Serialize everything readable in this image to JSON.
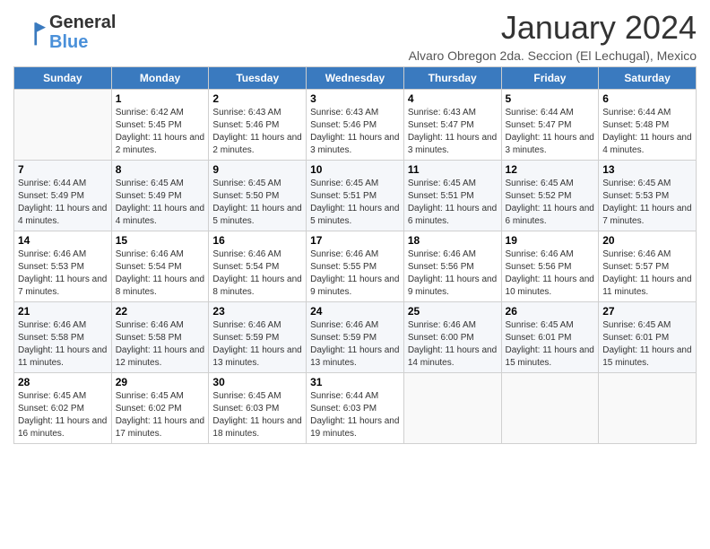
{
  "logo": {
    "general": "General",
    "blue": "Blue"
  },
  "title": "January 2024",
  "location": "Alvaro Obregon 2da. Seccion (El Lechugal), Mexico",
  "days_header": [
    "Sunday",
    "Monday",
    "Tuesday",
    "Wednesday",
    "Thursday",
    "Friday",
    "Saturday"
  ],
  "weeks": [
    [
      {
        "day": "",
        "info": ""
      },
      {
        "day": "1",
        "info": "Sunrise: 6:42 AM\nSunset: 5:45 PM\nDaylight: 11 hours and 2 minutes."
      },
      {
        "day": "2",
        "info": "Sunrise: 6:43 AM\nSunset: 5:46 PM\nDaylight: 11 hours and 2 minutes."
      },
      {
        "day": "3",
        "info": "Sunrise: 6:43 AM\nSunset: 5:46 PM\nDaylight: 11 hours and 3 minutes."
      },
      {
        "day": "4",
        "info": "Sunrise: 6:43 AM\nSunset: 5:47 PM\nDaylight: 11 hours and 3 minutes."
      },
      {
        "day": "5",
        "info": "Sunrise: 6:44 AM\nSunset: 5:47 PM\nDaylight: 11 hours and 3 minutes."
      },
      {
        "day": "6",
        "info": "Sunrise: 6:44 AM\nSunset: 5:48 PM\nDaylight: 11 hours and 4 minutes."
      }
    ],
    [
      {
        "day": "7",
        "info": "Sunrise: 6:44 AM\nSunset: 5:49 PM\nDaylight: 11 hours and 4 minutes."
      },
      {
        "day": "8",
        "info": "Sunrise: 6:45 AM\nSunset: 5:49 PM\nDaylight: 11 hours and 4 minutes."
      },
      {
        "day": "9",
        "info": "Sunrise: 6:45 AM\nSunset: 5:50 PM\nDaylight: 11 hours and 5 minutes."
      },
      {
        "day": "10",
        "info": "Sunrise: 6:45 AM\nSunset: 5:51 PM\nDaylight: 11 hours and 5 minutes."
      },
      {
        "day": "11",
        "info": "Sunrise: 6:45 AM\nSunset: 5:51 PM\nDaylight: 11 hours and 6 minutes."
      },
      {
        "day": "12",
        "info": "Sunrise: 6:45 AM\nSunset: 5:52 PM\nDaylight: 11 hours and 6 minutes."
      },
      {
        "day": "13",
        "info": "Sunrise: 6:45 AM\nSunset: 5:53 PM\nDaylight: 11 hours and 7 minutes."
      }
    ],
    [
      {
        "day": "14",
        "info": "Sunrise: 6:46 AM\nSunset: 5:53 PM\nDaylight: 11 hours and 7 minutes."
      },
      {
        "day": "15",
        "info": "Sunrise: 6:46 AM\nSunset: 5:54 PM\nDaylight: 11 hours and 8 minutes."
      },
      {
        "day": "16",
        "info": "Sunrise: 6:46 AM\nSunset: 5:54 PM\nDaylight: 11 hours and 8 minutes."
      },
      {
        "day": "17",
        "info": "Sunrise: 6:46 AM\nSunset: 5:55 PM\nDaylight: 11 hours and 9 minutes."
      },
      {
        "day": "18",
        "info": "Sunrise: 6:46 AM\nSunset: 5:56 PM\nDaylight: 11 hours and 9 minutes."
      },
      {
        "day": "19",
        "info": "Sunrise: 6:46 AM\nSunset: 5:56 PM\nDaylight: 11 hours and 10 minutes."
      },
      {
        "day": "20",
        "info": "Sunrise: 6:46 AM\nSunset: 5:57 PM\nDaylight: 11 hours and 11 minutes."
      }
    ],
    [
      {
        "day": "21",
        "info": "Sunrise: 6:46 AM\nSunset: 5:58 PM\nDaylight: 11 hours and 11 minutes."
      },
      {
        "day": "22",
        "info": "Sunrise: 6:46 AM\nSunset: 5:58 PM\nDaylight: 11 hours and 12 minutes."
      },
      {
        "day": "23",
        "info": "Sunrise: 6:46 AM\nSunset: 5:59 PM\nDaylight: 11 hours and 13 minutes."
      },
      {
        "day": "24",
        "info": "Sunrise: 6:46 AM\nSunset: 5:59 PM\nDaylight: 11 hours and 13 minutes."
      },
      {
        "day": "25",
        "info": "Sunrise: 6:46 AM\nSunset: 6:00 PM\nDaylight: 11 hours and 14 minutes."
      },
      {
        "day": "26",
        "info": "Sunrise: 6:45 AM\nSunset: 6:01 PM\nDaylight: 11 hours and 15 minutes."
      },
      {
        "day": "27",
        "info": "Sunrise: 6:45 AM\nSunset: 6:01 PM\nDaylight: 11 hours and 15 minutes."
      }
    ],
    [
      {
        "day": "28",
        "info": "Sunrise: 6:45 AM\nSunset: 6:02 PM\nDaylight: 11 hours and 16 minutes."
      },
      {
        "day": "29",
        "info": "Sunrise: 6:45 AM\nSunset: 6:02 PM\nDaylight: 11 hours and 17 minutes."
      },
      {
        "day": "30",
        "info": "Sunrise: 6:45 AM\nSunset: 6:03 PM\nDaylight: 11 hours and 18 minutes."
      },
      {
        "day": "31",
        "info": "Sunrise: 6:44 AM\nSunset: 6:03 PM\nDaylight: 11 hours and 19 minutes."
      },
      {
        "day": "",
        "info": ""
      },
      {
        "day": "",
        "info": ""
      },
      {
        "day": "",
        "info": ""
      }
    ]
  ]
}
